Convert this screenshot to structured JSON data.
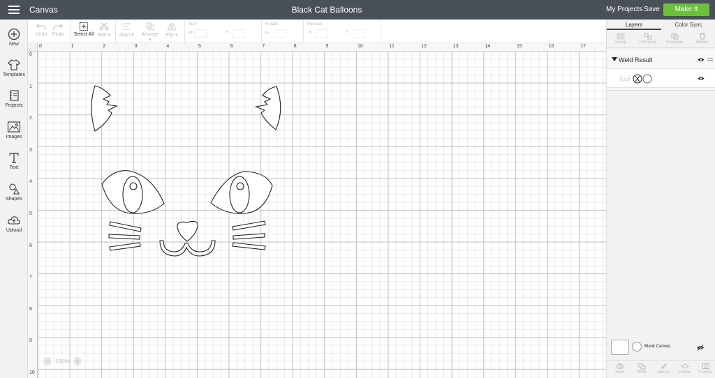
{
  "topbar": {
    "app_title": "Canvas",
    "project_title": "Black Cat Balloons",
    "my_projects": "My Projects",
    "save": "Save",
    "make_it": "Make It",
    "make_it_color": "#6cbf3b",
    "bar_color": "#4a5058"
  },
  "leftbar": {
    "items": [
      {
        "label": "New",
        "icon": "plus-circle-icon"
      },
      {
        "label": "Templates",
        "icon": "shirt-icon"
      },
      {
        "label": "Projects",
        "icon": "notebook-icon"
      },
      {
        "label": "Images",
        "icon": "image-icon"
      },
      {
        "label": "Text",
        "icon": "text-icon"
      },
      {
        "label": "Shapes",
        "icon": "shapes-icon"
      },
      {
        "label": "Upload",
        "icon": "cloud-upload-icon"
      }
    ]
  },
  "toolbar": {
    "undo": "Undo",
    "redo": "Redo",
    "select_all": "Select All",
    "edit": "Edit",
    "align": "Align",
    "arrange": "Arrange",
    "flip": "Flip",
    "size_label": "Size",
    "size_w": "W",
    "size_h": "H",
    "rotate_label": "Rotate",
    "position_label": "Position",
    "position_x": "X",
    "position_y": "Y"
  },
  "canvas": {
    "ruler_top": [
      "0",
      "1",
      "2",
      "3",
      "4",
      "5",
      "6",
      "7",
      "8",
      "9",
      "10",
      "11",
      "12",
      "13",
      "14",
      "15",
      "16",
      "17"
    ],
    "ruler_left": [
      "0",
      "1",
      "2",
      "3",
      "4",
      "5",
      "6",
      "7",
      "8",
      "9",
      "10"
    ],
    "zoom_minus": "−",
    "zoom_level": "100%",
    "zoom_plus": "+"
  },
  "rightpanel": {
    "tabs": [
      "Layers",
      "Color Sync"
    ],
    "layer_tools": [
      "Group",
      "UnGroup",
      "Duplicate",
      "Delete"
    ],
    "weld_result": "Weld Result",
    "blank_canvas": "Blank Canvas",
    "bottom_tools": [
      "Slice",
      "Weld",
      "Attach",
      "Flatten",
      "Contour"
    ]
  }
}
